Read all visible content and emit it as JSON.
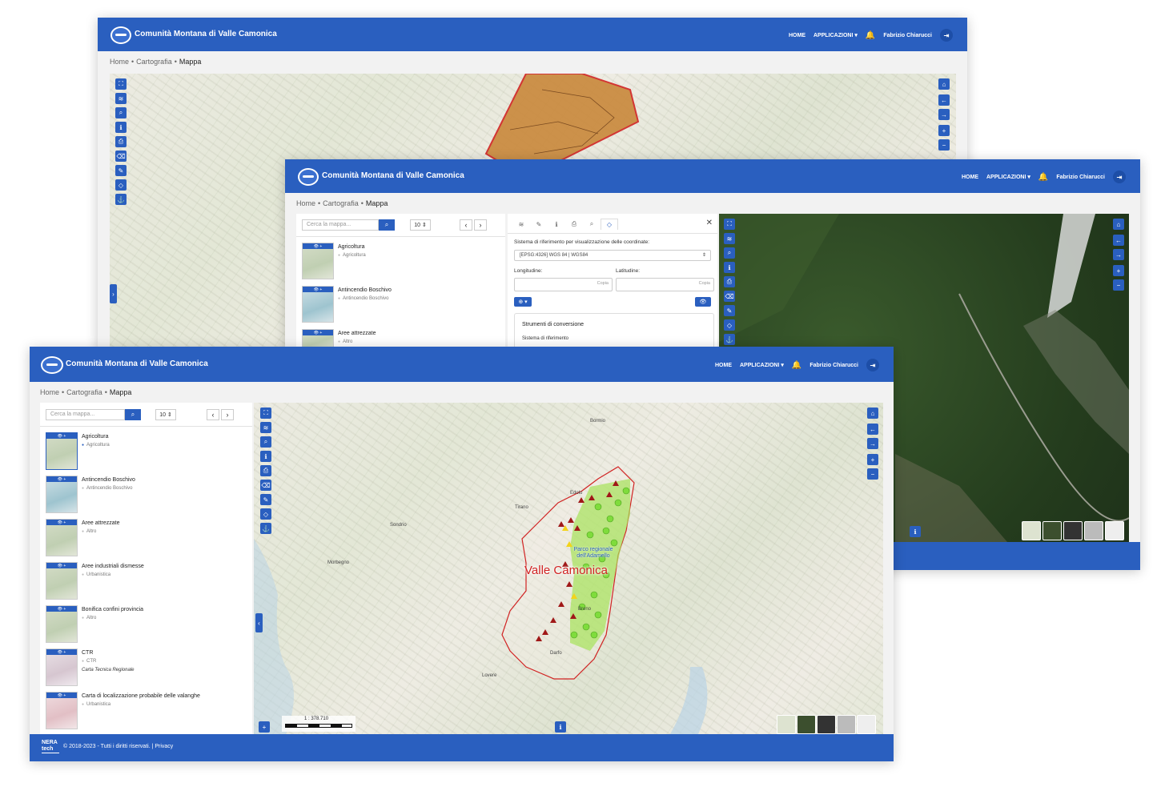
{
  "app": {
    "brand": "Comunità Montana di Valle Camonica",
    "nav_home": "HOME",
    "nav_apps": "APPLICAZIONI",
    "user": "Fabrizio Chiarucci"
  },
  "breadcrumb": {
    "home": "Home",
    "cartografia": "Cartografia",
    "current": "Mappa"
  },
  "sidebar": {
    "search_placeholder": "Cerca la mappa...",
    "page_size": "10",
    "layers": [
      {
        "title": "Agricoltura",
        "category": "Agricoltura"
      },
      {
        "title": "Antincendio Boschivo",
        "category": "Antincendio Boschivo"
      },
      {
        "title": "Aree attrezzate",
        "category": "Altro"
      },
      {
        "title": "Aree industriali dismesse",
        "category": "Urbanistica"
      },
      {
        "title": "Bonifica confini provincia",
        "category": "Altro"
      },
      {
        "title": "CTR",
        "category": "CTR",
        "note": "Carta Tecnica Regionale"
      },
      {
        "title": "Carta di localizzazione probabile delle valanghe",
        "category": "Urbanistica"
      }
    ]
  },
  "coord_panel": {
    "crs_label": "Sistema di riferimento per visualizzazione delle coordinate:",
    "crs_value": "[EPSG:4326] WGS 84 | WGS84",
    "lon_label": "Longitudine:",
    "lat_label": "Latitudine:",
    "copy": "Copia",
    "conv_title": "Strumenti di conversione",
    "conv_sub": "Sistema di riferimento"
  },
  "map": {
    "area_label": "Valle Camonica",
    "park_label": "Parco regionale dell'Adamello",
    "scale": "1 : 378.710",
    "places": [
      "Morbegno",
      "Tirano",
      "Bormio",
      "Edolo",
      "Breno",
      "Lovere",
      "Sondrio",
      "Darfo"
    ]
  },
  "footer": {
    "logo": "NERA tech",
    "text": "© 2018-2023 - Tutti i diritti riservati. | Privacy"
  },
  "icons": {
    "toolbar": [
      "expand-icon",
      "layers-icon",
      "search-icon",
      "info-icon",
      "print-icon",
      "eraser-icon",
      "pencil-icon",
      "coordinates-icon",
      "anchor-icon"
    ],
    "nav": [
      "home-icon",
      "arrow-left-icon",
      "arrow-right-icon",
      "zoom-in-icon",
      "zoom-out-icon"
    ]
  },
  "colors": {
    "accent": "#2a5fbf",
    "boundary": "#d12222",
    "park": "#9be04a",
    "marker": "#a01818"
  }
}
